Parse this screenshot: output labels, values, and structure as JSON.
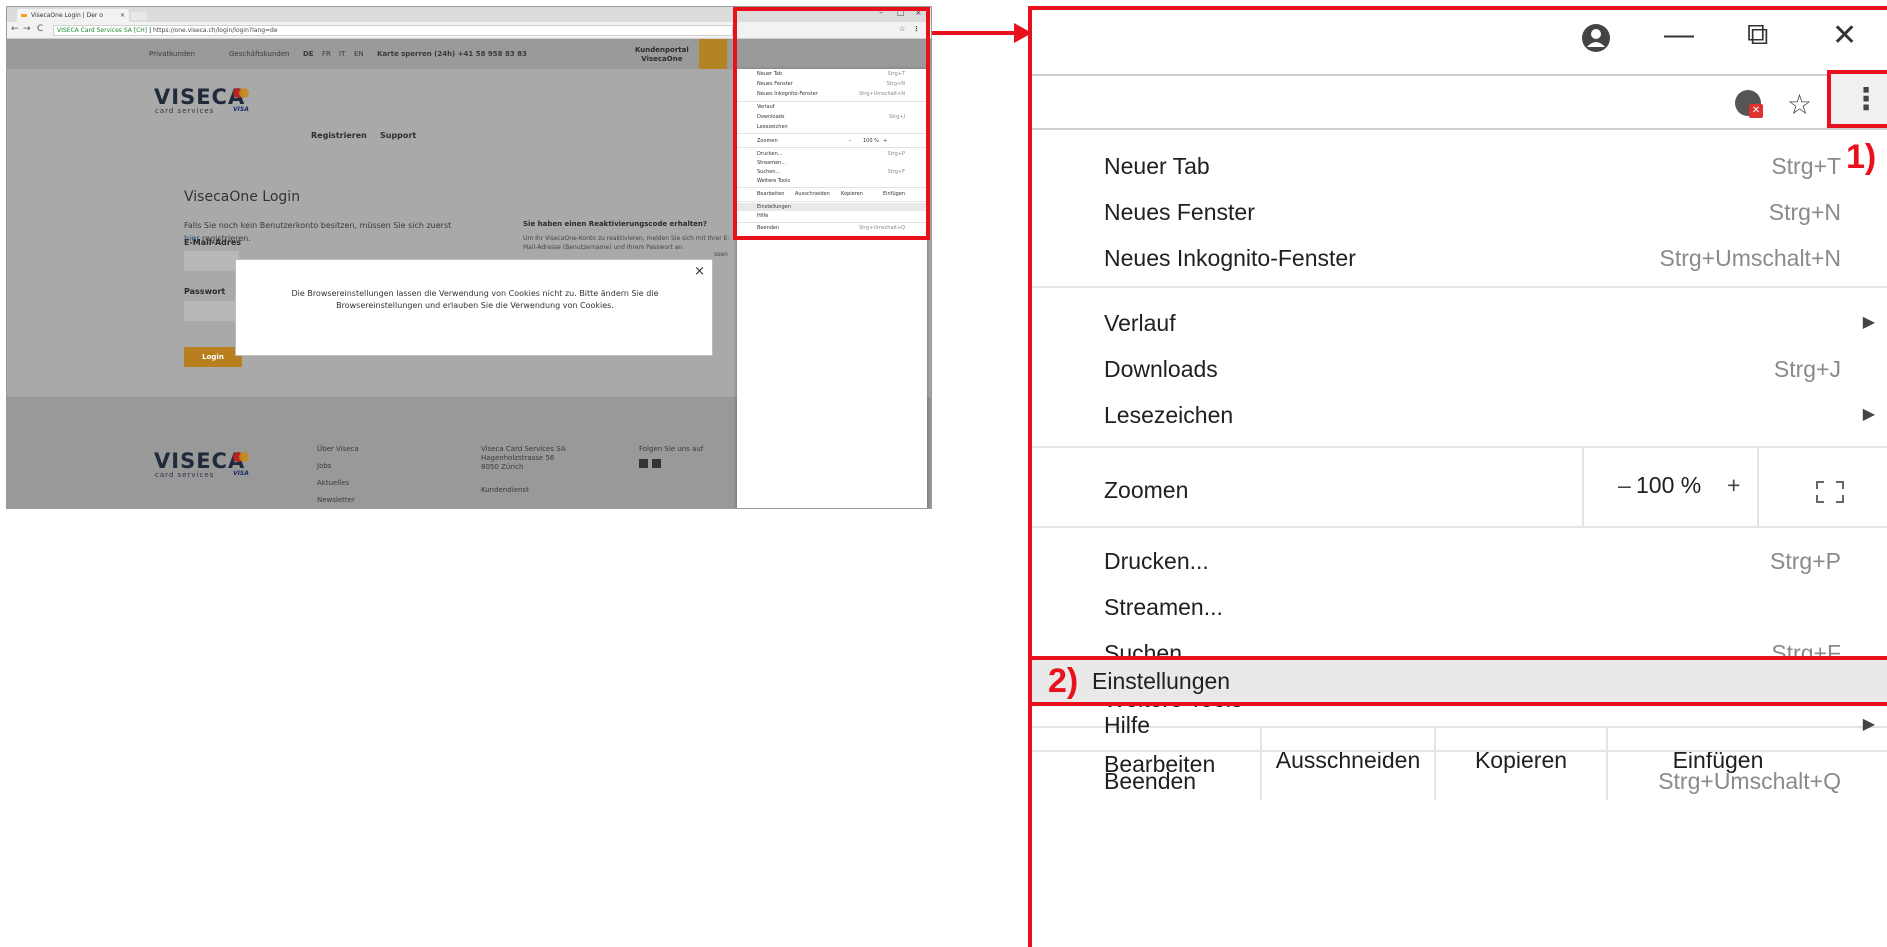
{
  "mini": {
    "tab_title": "VisecaOne Login | Der o",
    "tab_close": "×",
    "win_min": "–",
    "win_max": "□",
    "win_close": "×",
    "nav_back": "←",
    "nav_forward": "→",
    "nav_reload": "C",
    "url_secure": "VISECA Card Services SA [CH]",
    "url_separator": "|",
    "url_path": "https://one.viseca.ch/login/login?lang=de",
    "top_private": "Privatkunden",
    "top_business": "Geschäftskunden",
    "lang_de": "DE",
    "lang_fr": "FR",
    "lang_it": "IT",
    "lang_en": "EN",
    "top_block": "Karte sperren (24h) +41 58 958 83 83",
    "portal_line1": "Kundenportal",
    "portal_line2": "VisecaOne",
    "logo": "VISECA",
    "logo_sub": "card services",
    "visa": "VISA",
    "nav_register": "Registrieren",
    "nav_support": "Support",
    "login_title": "VisecaOne Login",
    "login_text_1": "Falls Sie noch kein Benutzerkonto besitzen, müssen Sie sich zuerst",
    "login_link": "hier",
    "login_text_2": " registrieren.",
    "react_title": "Sie haben einen Reaktivierungscode erhalten?",
    "react_text": "Um Ihr VisecaOne-Konto zu reaktivieren, melden Sie sich mit Ihrer E-Mail-Adresse (Benutzername) und Ihrem Passwort an.",
    "label_email": "E-Mail-Adres",
    "label_password": "Passwort",
    "side_text": "ssen",
    "login_button": "Login",
    "cookie_close": "×",
    "cookie_text": "Die Browsereinstellungen lassen die Verwendung von Cookies nicht zu. Bitte ändern Sie die Browsereinstellungen und erlauben Sie die Verwendung von Cookies.",
    "footer": {
      "col1": [
        "Über Viseca",
        "Jobs",
        "Aktuelles",
        "Newsletter"
      ],
      "address": [
        "Viseca Card Services SA",
        "Hagenholzstrasse 56",
        "8050 Zürich"
      ],
      "service": "Kundendienst",
      "follow": "Folgen Sie uns auf"
    },
    "menu": {
      "new_tab": "Neuer Tab",
      "new_tab_sc": "Strg+T",
      "new_window": "Neues Fenster",
      "new_window_sc": "Strg+N",
      "incognito": "Neues Inkognito-Fenster",
      "incognito_sc": "Strg+Umschalt+N",
      "history": "Verlauf",
      "downloads": "Downloads",
      "downloads_sc": "Strg+J",
      "bookmarks": "Lesezeichen",
      "zoom": "Zoomen",
      "zoom_minus": "–",
      "zoom_value": "100 %",
      "zoom_plus": "+",
      "print": "Drucken...",
      "print_sc": "Strg+P",
      "cast": "Streamen...",
      "find": "Suchen...",
      "find_sc": "Strg+F",
      "more_tools": "Weitere Tools",
      "edit": "Bearbeiten",
      "cut": "Ausschneiden",
      "copy": "Kopieren",
      "paste": "Einfügen",
      "settings": "Einstellungen",
      "help": "Hilfe",
      "exit": "Beenden",
      "exit_sc": "Strg+Umschalt+Q"
    }
  },
  "zoomed": {
    "win_min": "—",
    "win_max": "⧉",
    "win_close": "✕",
    "star": "☆",
    "menu_dots": "⋮",
    "callout_1": "1)",
    "callout_2": "2)",
    "menu": {
      "new_tab": "Neuer Tab",
      "new_tab_sc": "Strg+T",
      "new_window": "Neues Fenster",
      "new_window_sc": "Strg+N",
      "incognito": "Neues Inkognito-Fenster",
      "incognito_sc": "Strg+Umschalt+N",
      "history": "Verlauf",
      "downloads": "Downloads",
      "downloads_sc": "Strg+J",
      "bookmarks": "Lesezeichen",
      "zoom": "Zoomen",
      "zoom_minus": "–",
      "zoom_value": "100 %",
      "zoom_plus": "+",
      "print": "Drucken...",
      "print_sc": "Strg+P",
      "cast": "Streamen...",
      "find": "Suchen...",
      "find_sc": "Strg+F",
      "more_tools": "Weitere Tools",
      "edit": "Bearbeiten",
      "cut": "Ausschneiden",
      "copy": "Kopieren",
      "paste": "Einfügen",
      "settings": "Einstellungen",
      "help": "Hilfe",
      "exit": "Beenden",
      "exit_sc": "Strg+Umschalt+Q",
      "submenu_arrow": "▶"
    }
  },
  "colors": {
    "highlight": "#e8101a",
    "viseca_orange": "#b97f1f"
  }
}
